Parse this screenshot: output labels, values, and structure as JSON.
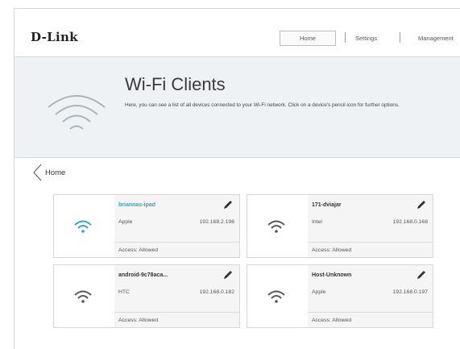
{
  "brand": {
    "logo": "D-Link"
  },
  "nav": {
    "home": "Home",
    "settings": "Settings",
    "management": "Management"
  },
  "banner": {
    "title": "Wi-Fi Clients",
    "description": "Here, you can see a list of all devices connected to your Wi-Fi network. Click on a device's pencil icon for further options.",
    "icon": "wifi-icon"
  },
  "back": {
    "label": "Home",
    "icon": "chevron-left-icon"
  },
  "clients": [
    {
      "name": "briannas-ipad",
      "vendor": "Apple",
      "ip": "192.168.2.196",
      "access": "Access: Allowed",
      "active": true
    },
    {
      "name": "171-dviajar",
      "vendor": "Intel",
      "ip": "192.168.0.168",
      "access": "Access: Allowed",
      "active": false
    },
    {
      "name": "android-9c78aca...",
      "vendor": "HTC",
      "ip": "192.168.0.182",
      "access": "Access: Allowed",
      "active": false
    },
    {
      "name": "Host-Unknown",
      "vendor": "Apple",
      "ip": "192.168.0.197",
      "access": "Access: Allowed",
      "active": false
    }
  ],
  "colors": {
    "accent": "#2ba6c6",
    "inactive_wifi": "#555555",
    "banner_bg": "#eef2f5"
  }
}
